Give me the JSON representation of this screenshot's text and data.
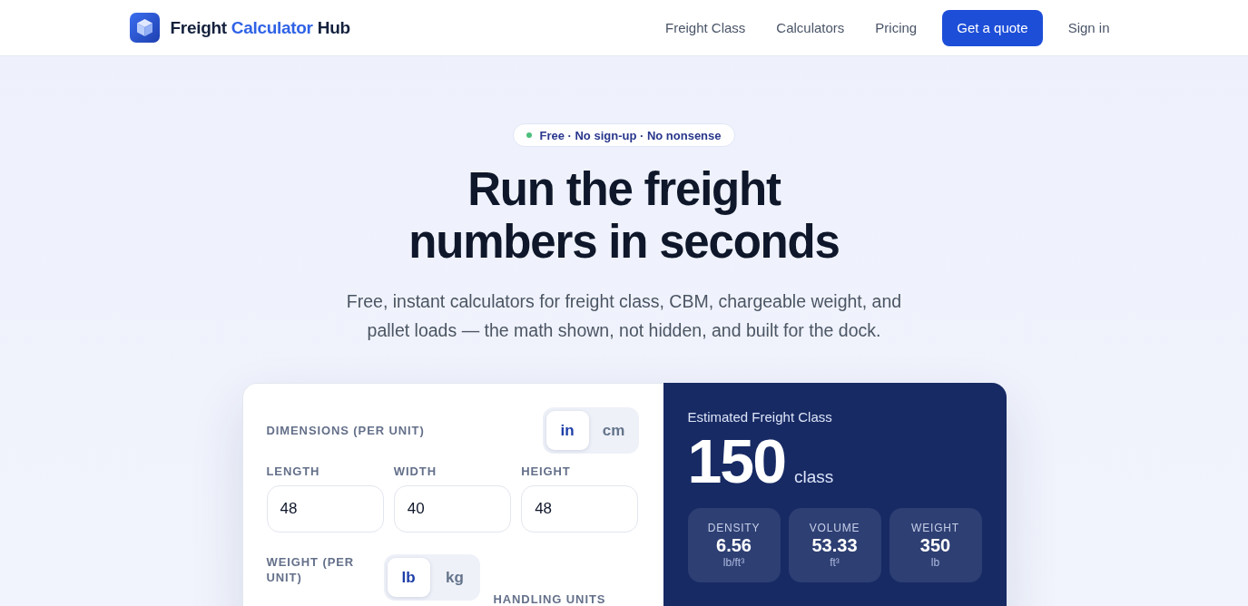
{
  "header": {
    "brand": {
      "lead": "Freight",
      "highlight": "Calculator",
      "tail": "Hub"
    },
    "nav": [
      {
        "label": "Freight Class",
        "kind": "link"
      },
      {
        "label": "Calculators",
        "kind": "link"
      },
      {
        "label": "Pricing",
        "kind": "link"
      },
      {
        "label": "Get a quote",
        "kind": "button"
      },
      {
        "label": "Sign in",
        "kind": "link"
      }
    ]
  },
  "hero": {
    "badge": "Free · No sign-up · No nonsense",
    "title": "Run the freight numbers in seconds",
    "subtitle": "Free, instant calculators for freight class, CBM, chargeable weight, and pallet loads — the math shown, not hidden, and built for the dock."
  },
  "calculator": {
    "dimensions_label": "DIMENSIONS (PER UNIT)",
    "dimension_units": [
      {
        "label": "in",
        "selected": true
      },
      {
        "label": "cm",
        "selected": false
      }
    ],
    "fields": [
      {
        "label": "LENGTH",
        "value": "48"
      },
      {
        "label": "WIDTH",
        "value": "40"
      },
      {
        "label": "HEIGHT",
        "value": "48"
      }
    ],
    "weight_label": "WEIGHT (PER UNIT)",
    "weight_units": [
      {
        "label": "lb",
        "selected": true
      },
      {
        "label": "kg",
        "selected": false
      }
    ],
    "handling_units_label": "HANDLING UNITS"
  },
  "result": {
    "title": "Estimated Freight Class",
    "value": "150",
    "suffix": "class",
    "stats": [
      {
        "label": "DENSITY",
        "value": "6.56",
        "unit": "lb/ft³"
      },
      {
        "label": "VOLUME",
        "value": "53.33",
        "unit": "ft³"
      },
      {
        "label": "WEIGHT",
        "value": "350",
        "unit": "lb"
      }
    ]
  }
}
